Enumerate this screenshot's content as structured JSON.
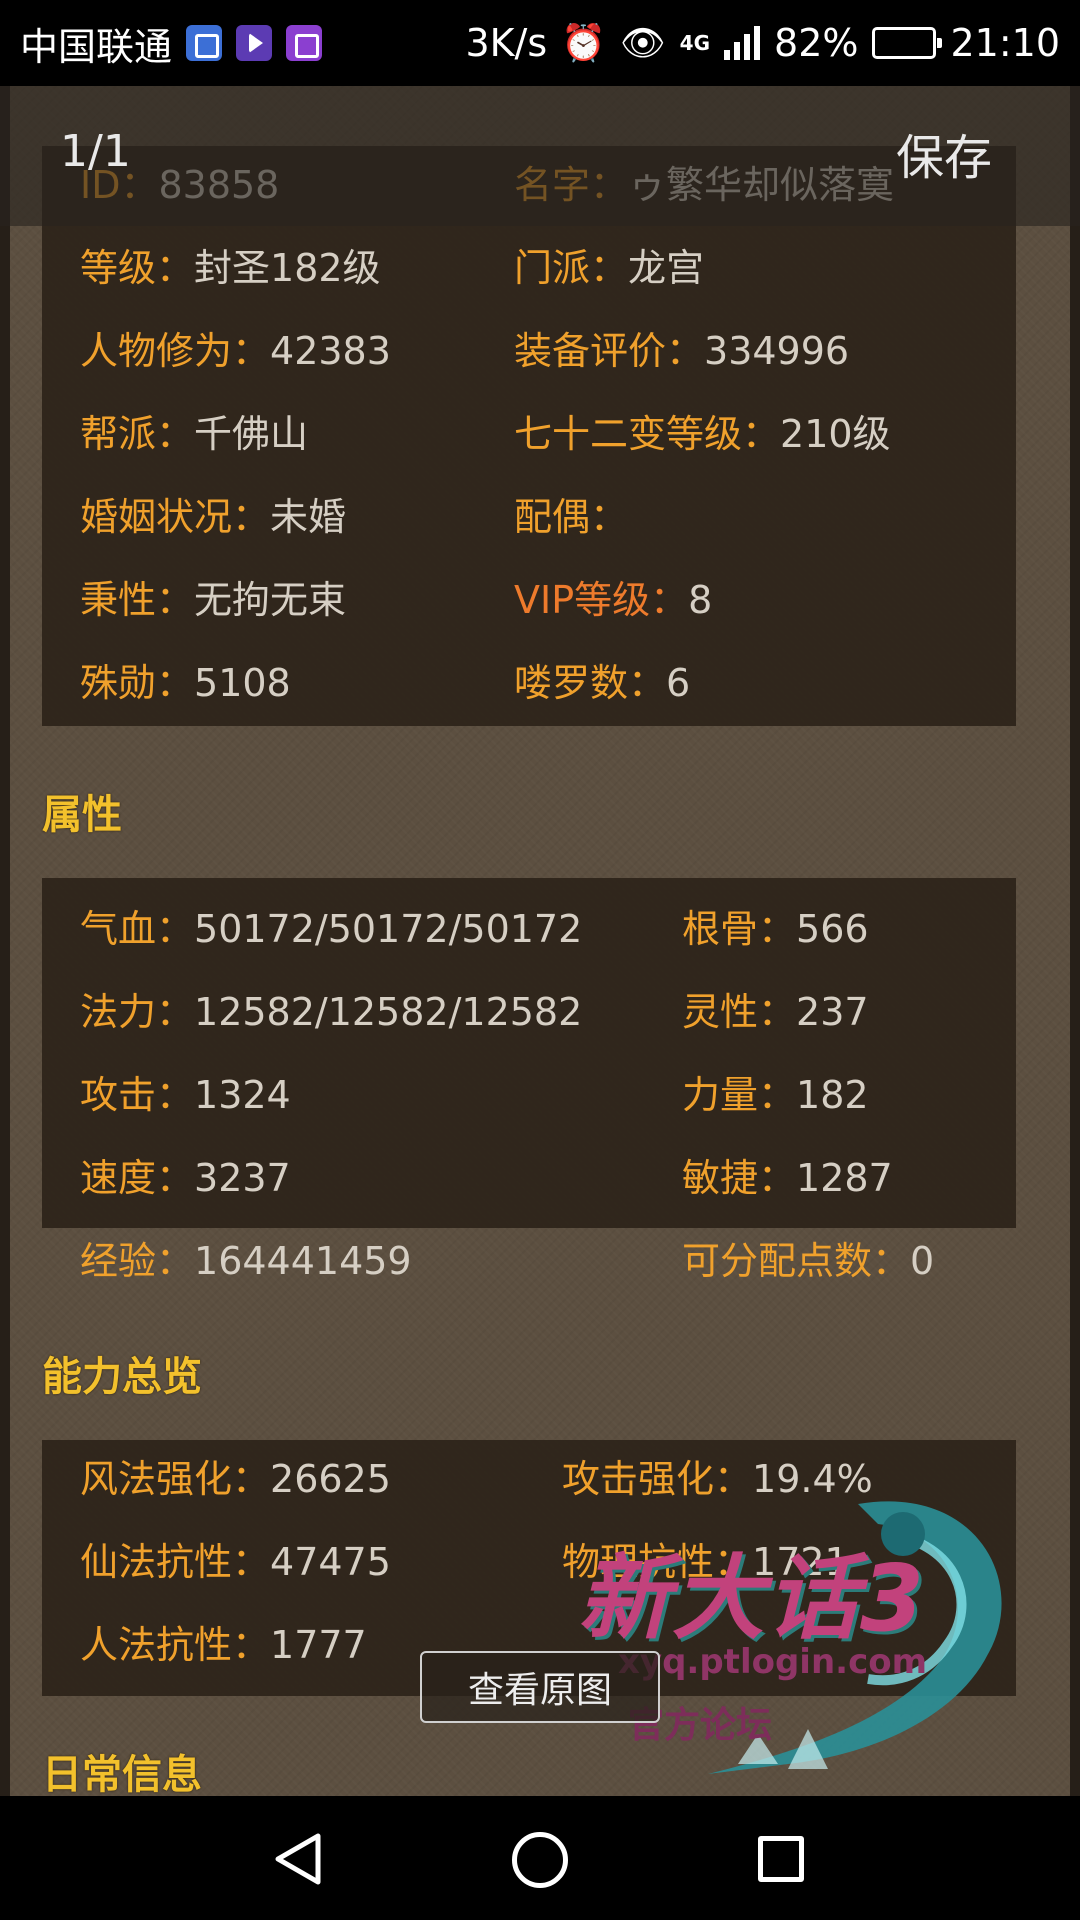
{
  "status_bar": {
    "carrier": "中国联通",
    "app_icons": [
      "health-icon",
      "video-icon",
      "keyboard-icon"
    ],
    "net_speed": "3K/s",
    "alarm_icon": "⏰",
    "eye_icon": "👁",
    "network_badge": "4G",
    "network_badge_small": "4G",
    "battery_percent": "82%",
    "battery_level": 0.82,
    "time": "21:10"
  },
  "viewer": {
    "page_counter": "1/1",
    "save_label": "保存",
    "view_original_label": "查看原图"
  },
  "basic_info": {
    "rows": [
      {
        "left": {
          "label": "ID：",
          "value": "83858"
        },
        "right": {
          "label": "名字：",
          "value": "ゥ繁华却似落寞"
        }
      },
      {
        "left": {
          "label": "等级：",
          "value": "封圣182级"
        },
        "right": {
          "label": "门派：",
          "value": "龙宫"
        }
      },
      {
        "left": {
          "label": "人物修为：",
          "value": "42383"
        },
        "right": {
          "label": "装备评价：",
          "value": "334996"
        }
      },
      {
        "left": {
          "label": "帮派：",
          "value": "千佛山"
        },
        "right": {
          "label": "七十二变等级：",
          "value": "210级"
        }
      },
      {
        "left": {
          "label": "婚姻状况：",
          "value": "未婚"
        },
        "right": {
          "label": "配偶：",
          "value": ""
        }
      },
      {
        "left": {
          "label": "秉性：",
          "value": "无拘无束"
        },
        "right": {
          "label": "VIP等级：",
          "value": "8"
        }
      },
      {
        "left": {
          "label": "殊勋：",
          "value": "5108"
        },
        "right": {
          "label": "喽罗数：",
          "value": "6"
        }
      }
    ]
  },
  "attributes": {
    "title": "属性",
    "rows": [
      {
        "left": {
          "label": "气血：",
          "value": "50172/50172/50172"
        },
        "right": {
          "label": "根骨：",
          "value": "566"
        }
      },
      {
        "left": {
          "label": "法力：",
          "value": "12582/12582/12582"
        },
        "right": {
          "label": "灵性：",
          "value": "237"
        }
      },
      {
        "left": {
          "label": "攻击：",
          "value": "1324"
        },
        "right": {
          "label": "力量：",
          "value": "182"
        }
      },
      {
        "left": {
          "label": "速度：",
          "value": "3237"
        },
        "right": {
          "label": "敏捷：",
          "value": "1287"
        }
      },
      {
        "left": {
          "label": "经验：",
          "value": "164441459"
        },
        "right": {
          "label": "可分配点数：",
          "value": "0"
        }
      }
    ]
  },
  "ability": {
    "title": "能力总览",
    "rows": [
      {
        "left": {
          "label": "风法强化：",
          "value": "26625"
        },
        "right": {
          "label": "攻击强化：",
          "value": "19.4%"
        }
      },
      {
        "left": {
          "label": "仙法抗性：",
          "value": "47475"
        },
        "right": {
          "label": "物理抗性：",
          "value": "1721"
        }
      },
      {
        "left": {
          "label": "人法抗性：",
          "value": "1777"
        },
        "right": {
          "label": "",
          "value": ""
        }
      }
    ]
  },
  "daily": {
    "title": "日常信息"
  },
  "watermark": {
    "title": "新大话3",
    "url": "xyq.ptlogin.com",
    "sub": "官方论坛"
  },
  "nav_bar": {
    "back_icon": "back-triangle",
    "home_icon": "home-circle",
    "recent_icon": "recent-square"
  }
}
